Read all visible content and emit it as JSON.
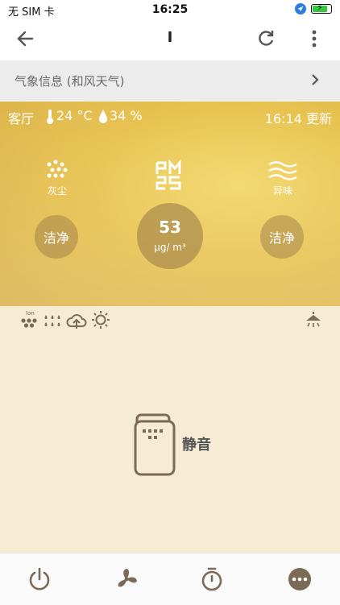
{
  "status_bar": {
    "carrier": "无 SIM 卡",
    "time": "16:25"
  },
  "header": {
    "title": "I"
  },
  "weather": {
    "label": "气象信息 (和风天气)"
  },
  "panel": {
    "room": "客厅",
    "temperature": "24 °C",
    "humidity": "34 %",
    "update": "16:14 更新",
    "dust_label": "灰尘",
    "odor_label": "异味",
    "dust_status": "洁净",
    "odor_status": "洁净",
    "pm25_value": "53",
    "pm25_unit": "μg/ m³"
  },
  "device": {
    "mode": "静音"
  },
  "colors": {
    "panel": "#e8c24f",
    "lower": "#f6ecd4",
    "icon": "#7b6a56"
  }
}
